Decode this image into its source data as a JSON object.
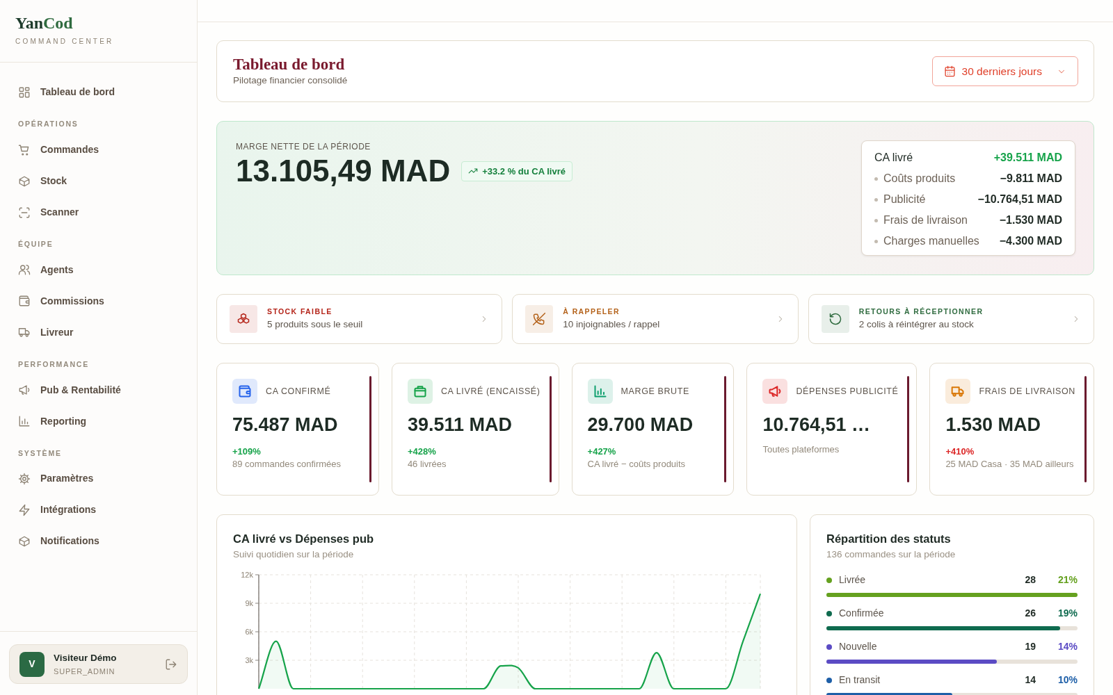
{
  "sidebar": {
    "brand": {
      "first": "Yan",
      "second": "Cod"
    },
    "tagline": "COMMAND CENTER",
    "groups": [
      {
        "items": [
          {
            "label": "Tableau de bord",
            "selected": false
          }
        ]
      },
      {
        "heading": "OPÉRATIONS",
        "items": [
          {
            "label": "Commandes",
            "selected": false
          },
          {
            "label": "Stock",
            "selected": false
          },
          {
            "label": "Scanner",
            "selected": false
          }
        ]
      },
      {
        "heading": "ÉQUIPE",
        "items": [
          {
            "label": "Agents",
            "selected": false
          },
          {
            "label": "Commissions",
            "selected": false
          },
          {
            "label": "Livreur",
            "selected": false
          }
        ]
      },
      {
        "heading": "PERFORMANCE",
        "items": [
          {
            "label": "Pub & Rentabilité",
            "selected": false
          },
          {
            "label": "Reporting",
            "selected": false
          }
        ]
      },
      {
        "heading": "SYSTÈME",
        "items": [
          {
            "label": "Paramètres",
            "selected": false
          },
          {
            "label": "Intégrations",
            "selected": false
          },
          {
            "label": "Notifications",
            "selected": false
          }
        ]
      }
    ],
    "user": {
      "initial": "V",
      "name": "Visiteur Démo",
      "role": "SUPER_ADMIN"
    }
  },
  "header": {
    "title": "Tableau de bord",
    "subtitle": "Pilotage financier consolidé",
    "period": "30 derniers jours"
  },
  "hero": {
    "label": "MARGE NETTE DE LA PÉRIODE",
    "value": "13.105,49 MAD",
    "badge": "+33.2 % du CA livré",
    "breakdown": [
      {
        "kind": "total",
        "label": "CA livré",
        "value": "+39.511 MAD"
      },
      {
        "kind": "cost",
        "label": "Coûts produits",
        "value": "−9.811 MAD"
      },
      {
        "kind": "cost",
        "label": "Publicité",
        "value": "−10.764,51 MAD"
      },
      {
        "kind": "cost",
        "label": "Frais de livraison",
        "value": "−1.530 MAD"
      },
      {
        "kind": "cost",
        "label": "Charges manuelles",
        "value": "−4.300 MAD"
      }
    ]
  },
  "alerts": [
    {
      "color": "#b42318",
      "title": "STOCK FAIBLE",
      "text": "5 produits sous le seuil"
    },
    {
      "color": "#b4621a",
      "title": "À RAPPELER",
      "text": "10 injoignables / rappel"
    },
    {
      "color": "#2f6b3f",
      "title": "RETOURS À RÉCEPTIONNER",
      "text": "2 colis à réintégrer au stock"
    }
  ],
  "kpis": [
    {
      "label": "CA CONFIRMÉ",
      "value": "75.487 MAD",
      "delta": "+109%",
      "negative": false,
      "note": "89 commandes confirmées",
      "color": "#2563eb"
    },
    {
      "label": "CA LIVRÉ (ENCAISSÉ)",
      "value": "39.511 MAD",
      "delta": "+428%",
      "negative": false,
      "note": "46 livrées",
      "color": "#16a34a"
    },
    {
      "label": "MARGE BRUTE",
      "value": "29.700 MAD",
      "delta": "+427%",
      "negative": false,
      "note": "CA livré − coûts produits",
      "color": "#0f9f6e"
    },
    {
      "label": "DÉPENSES PUBLICITÉ",
      "value": "10.764,51 …",
      "note": "Toutes plateformes",
      "color": "#dc2626"
    },
    {
      "label": "FRAIS DE LIVRAISON",
      "value": "1.530 MAD",
      "delta": "+410%",
      "negative": true,
      "note": "25 MAD Casa · 35 MAD ailleurs",
      "color": "#d97706"
    }
  ],
  "revenue_chart": {
    "title": "CA livré vs Dépenses pub",
    "subtitle": "Suivi quotidien sur la période",
    "chart_data": {
      "type": "area",
      "grid": true,
      "ylim": [
        0,
        12000
      ],
      "yticks": [
        {
          "value": 3000,
          "label": "3k"
        },
        {
          "value": 6000,
          "label": "6k"
        },
        {
          "value": 9000,
          "label": "9k"
        },
        {
          "value": 12000,
          "label": "12k"
        }
      ],
      "series": [
        {
          "color": "#16a34a",
          "values": [
            0,
            5000,
            0,
            0,
            0,
            0,
            0,
            0,
            0,
            0,
            0,
            0,
            0,
            0,
            2400,
            2200,
            0,
            0,
            0,
            0,
            0,
            0,
            0,
            3800,
            0,
            0,
            0,
            0,
            5000,
            10000
          ]
        }
      ]
    }
  },
  "statuses": {
    "title": "Répartition des statuts",
    "subtitle": "136 commandes sur la période",
    "items": [
      {
        "label": "Livrée",
        "count": "28",
        "percent": "21%",
        "color": "#65a11f",
        "level": 1.0
      },
      {
        "label": "Confirmée",
        "count": "26",
        "percent": "19%",
        "color": "#0f6b4f",
        "level": 0.93
      },
      {
        "label": "Nouvelle",
        "count": "19",
        "percent": "14%",
        "color": "#5b4bc4",
        "level": 0.68
      },
      {
        "label": "En transit",
        "count": "14",
        "percent": "10%",
        "color": "#1e5fa8",
        "level": 0.5
      }
    ]
  }
}
